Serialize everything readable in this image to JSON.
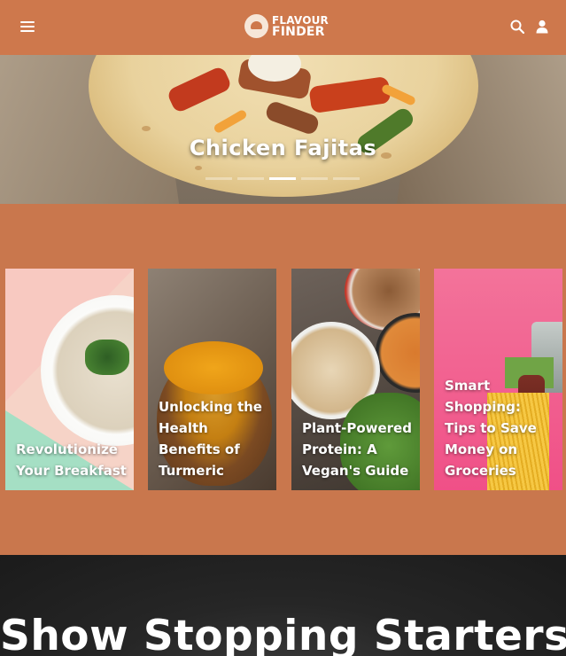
{
  "header": {
    "logo_line1": "FLAVOUR",
    "logo_line2": "FINDER",
    "icons": [
      "menu-icon",
      "search-icon",
      "user-icon"
    ]
  },
  "hero": {
    "title": "Chicken Fajitas",
    "slides_total": 5,
    "active_slide": 3
  },
  "cards": [
    {
      "title": "Revolutionize Your Breakfast"
    },
    {
      "title": "Unlocking the Health Benefits of Turmeric"
    },
    {
      "title": "Plant-Powered Protein: A Vegan's Guide"
    },
    {
      "title": "Smart Shopping: Tips to Save Money on Groceries"
    }
  ],
  "banner": {
    "title": "Show Stopping Starters!"
  },
  "colors": {
    "brand": "#ce784c",
    "background": "#c9774d"
  }
}
